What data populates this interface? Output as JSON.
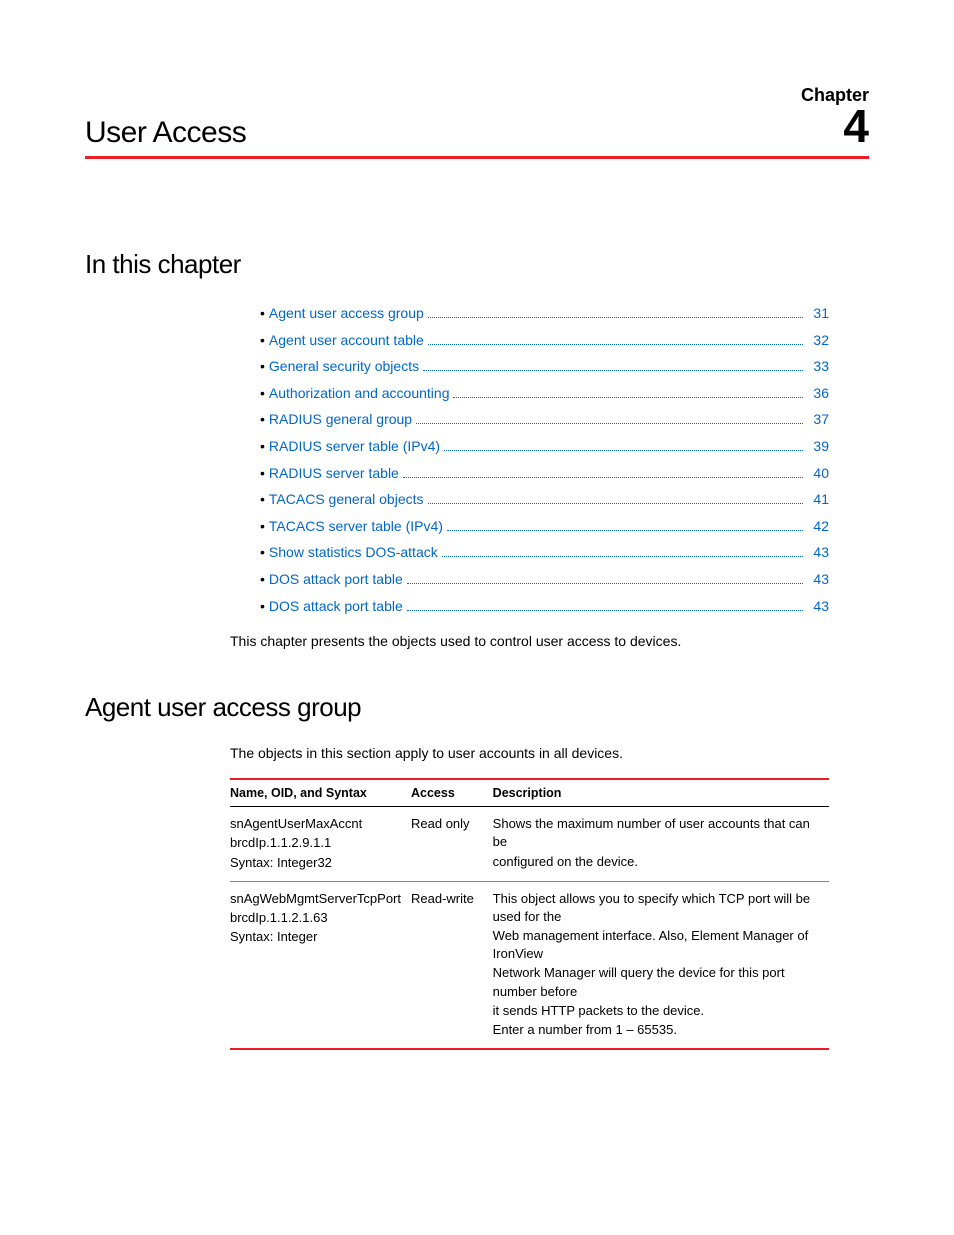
{
  "chapter_label": "Chapter",
  "chapter_number": "4",
  "page_title": "User Access",
  "section_in_this_chapter": "In this chapter",
  "toc": [
    {
      "label": "Agent user access group",
      "page": "31"
    },
    {
      "label": "Agent user account table",
      "page": "32"
    },
    {
      "label": "General security objects",
      "page": "33"
    },
    {
      "label": "Authorization and accounting",
      "page": "36"
    },
    {
      "label": "RADIUS general group",
      "page": "37"
    },
    {
      "label": "RADIUS server table (IPv4)",
      "page": "39"
    },
    {
      "label": "RADIUS server table",
      "page": "40"
    },
    {
      "label": "TACACS general objects",
      "page": "41"
    },
    {
      "label": "TACACS server table (IPv4)",
      "page": "42"
    },
    {
      "label": "Show statistics DOS-attack",
      "page": "43"
    },
    {
      "label": "DOS attack port table",
      "page": "43"
    },
    {
      "label": "DOS attack port table",
      "page": "43"
    }
  ],
  "chapter_intro": "This chapter presents the objects used to control user access to devices.",
  "section_agent_group": "Agent user access group",
  "agent_group_intro": "The objects in this section apply to user accounts in all devices.",
  "table_headers": {
    "name": "Name, OID, and Syntax",
    "access": "Access",
    "description": "Description"
  },
  "rows": [
    {
      "name_l1": "snAgentUserMaxAccnt",
      "name_l2": "brcdIp.1.1.2.9.1.1",
      "name_l3": "Syntax: Integer32",
      "access": "Read only",
      "desc_l1": "Shows the maximum number of user accounts that can be",
      "desc_l2": "configured on the device.",
      "desc_l3": "",
      "desc_l4": "",
      "desc_l5": ""
    },
    {
      "name_l1": "snAgWebMgmtServerTcpPort",
      "name_l2": "brcdIp.1.1.2.1.63",
      "name_l3": "Syntax: Integer",
      "access": "Read-write",
      "desc_l1": "This object allows you to specify which TCP port will be used for the",
      "desc_l2": "Web management interface. Also, Element Manager of IronView",
      "desc_l3": "Network Manager will query the device for this port number before",
      "desc_l4": "it sends HTTP packets to the device.",
      "desc_l5": "Enter a number from 1 – 65535."
    }
  ]
}
